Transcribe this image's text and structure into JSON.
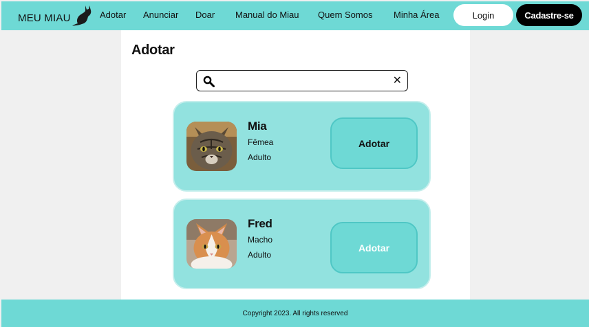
{
  "header": {
    "brand": "MEU MIAU",
    "nav": [
      "Adotar",
      "Anunciar",
      "Doar",
      "Manual do Miau",
      "Quem Somos",
      "Minha Área"
    ],
    "login_label": "Login",
    "signup_label": "Cadastre-se"
  },
  "page": {
    "title": "Adotar"
  },
  "search": {
    "value": "",
    "placeholder": ""
  },
  "pets": [
    {
      "name": "Mia",
      "sex": "Fêmea",
      "age": "Adulto",
      "button": "Adotar"
    },
    {
      "name": "Fred",
      "sex": "Macho",
      "age": "Adulto",
      "button": "Adotar"
    }
  ],
  "footer": {
    "copyright": "Copyright 2023. All rights reserved"
  },
  "colors": {
    "accent": "#6ed9d5",
    "card": "#92e2df",
    "background": "#f0f0f0"
  }
}
